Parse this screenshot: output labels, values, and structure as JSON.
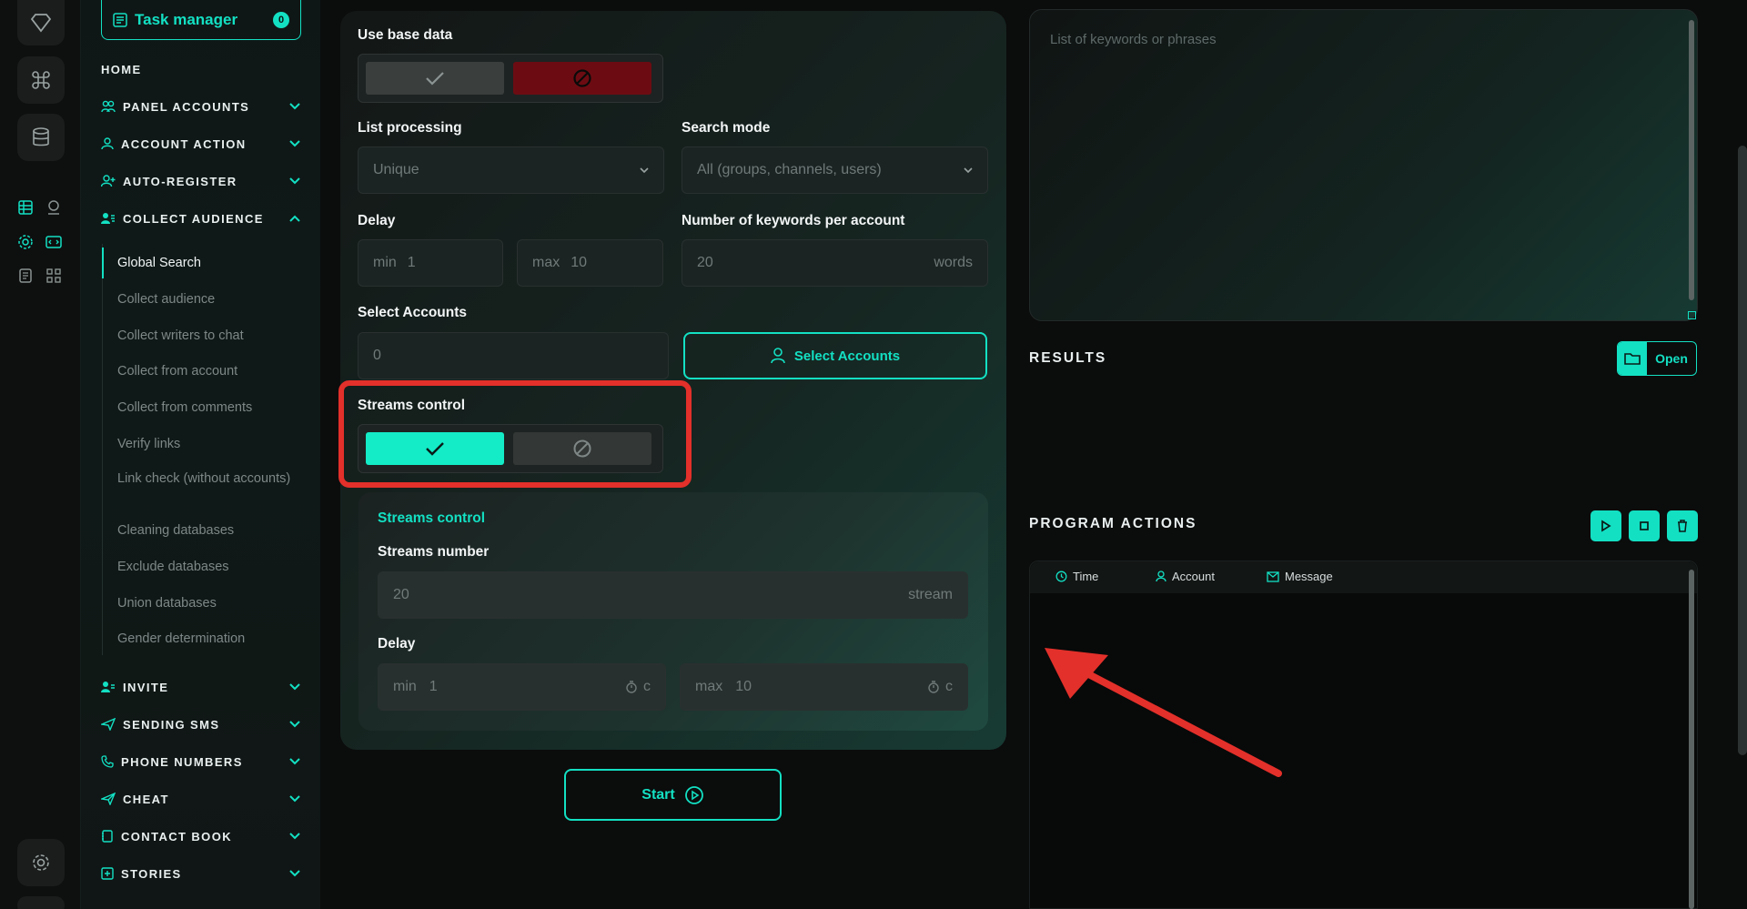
{
  "sidebar": {
    "task_manager": "Task manager",
    "task_badge": "0",
    "home": "HOME",
    "sections": [
      {
        "label": "PANEL ACCOUNTS"
      },
      {
        "label": "ACCOUNT ACTION"
      },
      {
        "label": "AUTO-REGISTER"
      },
      {
        "label": "COLLECT AUDIENCE"
      },
      {
        "label": "INVITE"
      },
      {
        "label": "SENDING SMS"
      },
      {
        "label": "PHONE NUMBERS"
      },
      {
        "label": "CHEAT"
      },
      {
        "label": "CONTACT BOOK"
      },
      {
        "label": "STORIES"
      }
    ],
    "sub_items": [
      "Global Search",
      "Collect audience",
      "Collect writers to chat",
      "Collect from account",
      "Collect from comments",
      "Verify links",
      "Link check (without accounts)",
      "Cleaning databases",
      "Exclude databases",
      "Union databases",
      "Gender determination"
    ]
  },
  "form": {
    "use_base_data": "Use base data",
    "list_processing": "List processing",
    "list_processing_value": "Unique",
    "search_mode": "Search mode",
    "search_mode_value": "All (groups, channels, users)",
    "delay": "Delay",
    "delay_min_label": "min",
    "delay_min": "1",
    "delay_max_label": "max",
    "delay_max": "10",
    "keywords_per_account": "Number of keywords per account",
    "keywords_value": "20",
    "keywords_unit": "words",
    "select_accounts": "Select Accounts",
    "select_accounts_value": "0",
    "select_accounts_button": "Select Accounts",
    "streams_control": "Streams control",
    "streams_panel_title": "Streams control",
    "streams_number": "Streams number",
    "streams_number_value": "20",
    "streams_unit": "stream",
    "streams_delay": "Delay",
    "streams_delay_min_label": "min",
    "streams_delay_min": "1",
    "streams_delay_max_label": "max",
    "streams_delay_max": "10",
    "seconds_unit": "c",
    "start": "Start"
  },
  "right": {
    "keywords_placeholder": "List of keywords or phrases",
    "results": "RESULTS",
    "open": "Open",
    "program_actions": "PROGRAM ACTIONS",
    "col_time": "Time",
    "col_account": "Account",
    "col_message": "Message"
  },
  "colors": {
    "accent": "#13e0c3",
    "highlight": "#e3302a",
    "deny": "#6c0c12"
  }
}
